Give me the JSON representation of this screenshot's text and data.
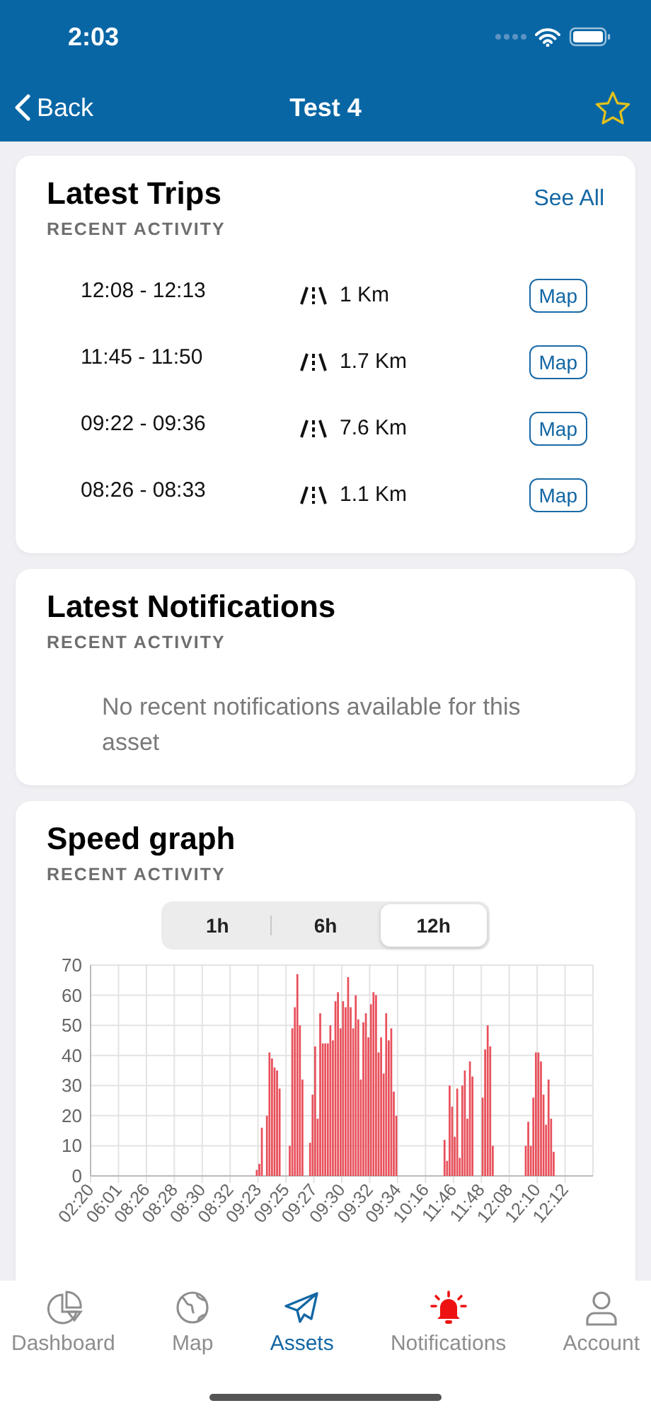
{
  "status_bar": {
    "time": "2:03"
  },
  "nav": {
    "back": "Back",
    "title": "Test 4",
    "favorite": false
  },
  "trips_card": {
    "title": "Latest Trips",
    "subtitle": "RECENT ACTIVITY",
    "see_all": "See All",
    "trips": [
      {
        "time": "12:08 - 12:13",
        "distance": "1 Km",
        "button": "Map"
      },
      {
        "time": "11:45 - 11:50",
        "distance": "1.7 Km",
        "button": "Map"
      },
      {
        "time": "09:22 - 09:36",
        "distance": "7.6 Km",
        "button": "Map"
      },
      {
        "time": "08:26 - 08:33",
        "distance": "1.1 Km",
        "button": "Map"
      }
    ]
  },
  "notifications_card": {
    "title": "Latest Notifications",
    "subtitle": "RECENT ACTIVITY",
    "message": "No recent notifications available for this asset"
  },
  "speed_card": {
    "title": "Speed graph",
    "subtitle": "RECENT ACTIVITY",
    "ranges": [
      {
        "label": "1h",
        "selected": false
      },
      {
        "label": "6h",
        "selected": false
      },
      {
        "label": "12h",
        "selected": true
      }
    ],
    "chart_data": {
      "type": "bar",
      "grid": true,
      "ylim": [
        0,
        70
      ],
      "yticks": [
        0,
        10,
        20,
        30,
        40,
        50,
        60,
        70
      ],
      "categories": [
        "02:20",
        null,
        null,
        null,
        null,
        null,
        null,
        null,
        null,
        null,
        null,
        "06:01",
        null,
        null,
        null,
        null,
        null,
        null,
        null,
        null,
        null,
        null,
        "08:26",
        null,
        null,
        null,
        null,
        null,
        null,
        null,
        null,
        null,
        null,
        "08:28",
        null,
        null,
        null,
        null,
        null,
        null,
        null,
        null,
        null,
        null,
        "08:30",
        null,
        null,
        null,
        null,
        null,
        null,
        null,
        null,
        null,
        null,
        "08:32",
        null,
        null,
        null,
        null,
        null,
        null,
        null,
        null,
        null,
        null,
        "09:23",
        null,
        null,
        null,
        null,
        null,
        null,
        null,
        null,
        null,
        null,
        "09:25",
        null,
        null,
        null,
        null,
        null,
        null,
        null,
        null,
        null,
        null,
        "09:27",
        null,
        null,
        null,
        null,
        null,
        null,
        null,
        null,
        null,
        null,
        "09:30",
        null,
        null,
        null,
        null,
        null,
        null,
        null,
        null,
        null,
        null,
        "09:32",
        null,
        null,
        null,
        null,
        null,
        null,
        null,
        null,
        null,
        null,
        "09:34",
        null,
        null,
        null,
        null,
        null,
        null,
        null,
        null,
        null,
        null,
        "10:16",
        null,
        null,
        null,
        null,
        null,
        null,
        null,
        null,
        null,
        null,
        "11:46",
        null,
        null,
        null,
        null,
        null,
        null,
        null,
        null,
        null,
        null,
        "11:48",
        null,
        null,
        null,
        null,
        null,
        null,
        null,
        null,
        null,
        null,
        "12:08",
        null,
        null,
        null,
        null,
        null,
        null,
        null,
        null,
        null,
        null,
        "12:10",
        null,
        null,
        null,
        null,
        null,
        null,
        null,
        null,
        null,
        null,
        "12:12",
        null,
        null,
        null,
        null,
        null,
        null,
        null,
        null,
        null,
        null
      ],
      "series": [
        {
          "color": "#e8505b",
          "values": [
            0,
            0,
            0,
            0,
            0,
            0,
            0,
            0,
            0,
            0,
            0,
            0,
            0,
            0,
            0,
            0,
            0,
            0,
            0,
            0,
            0,
            0,
            0,
            0,
            0,
            0,
            0,
            0,
            0,
            0,
            0,
            0,
            0,
            0,
            0,
            0,
            0,
            0,
            0,
            0,
            0,
            0,
            0,
            0,
            0,
            0,
            0,
            0,
            0,
            0,
            0,
            0,
            0,
            0,
            0,
            0,
            0,
            0,
            0,
            0,
            0,
            0,
            0,
            0,
            0,
            2,
            4,
            16,
            0,
            20,
            41,
            39,
            36,
            35,
            29,
            0,
            0,
            0,
            10,
            49,
            56,
            67,
            50,
            32,
            0,
            0,
            11,
            27,
            43,
            19,
            54,
            44,
            44,
            44,
            50,
            45,
            58,
            61,
            49,
            58,
            56,
            66,
            56,
            49,
            60,
            52,
            32,
            51,
            54,
            46,
            57,
            61,
            60,
            41,
            46,
            34,
            54,
            45,
            49,
            28,
            20,
            0,
            0,
            0,
            0,
            0,
            0,
            0,
            0,
            0,
            0,
            0,
            0,
            0,
            0,
            0,
            0,
            0,
            0,
            12,
            5,
            30,
            23,
            13,
            29,
            6,
            30,
            35,
            19,
            38,
            33,
            0,
            0,
            0,
            26,
            42,
            50,
            43,
            10,
            0,
            0,
            0,
            0,
            0,
            0,
            0,
            0,
            0,
            0,
            0,
            0,
            10,
            18,
            10,
            26,
            41,
            41,
            38,
            27,
            17,
            32,
            19,
            8,
            0,
            0,
            0,
            0,
            0,
            0,
            0,
            0,
            0,
            0,
            0,
            0,
            0,
            0,
            0
          ]
        }
      ]
    }
  },
  "tabs": [
    {
      "label": "Dashboard",
      "selected": false,
      "alert": false
    },
    {
      "label": "Map",
      "selected": false,
      "alert": false
    },
    {
      "label": "Assets",
      "selected": true,
      "alert": false
    },
    {
      "label": "Notifications",
      "selected": false,
      "alert": true
    },
    {
      "label": "Account",
      "selected": false,
      "alert": false
    }
  ]
}
